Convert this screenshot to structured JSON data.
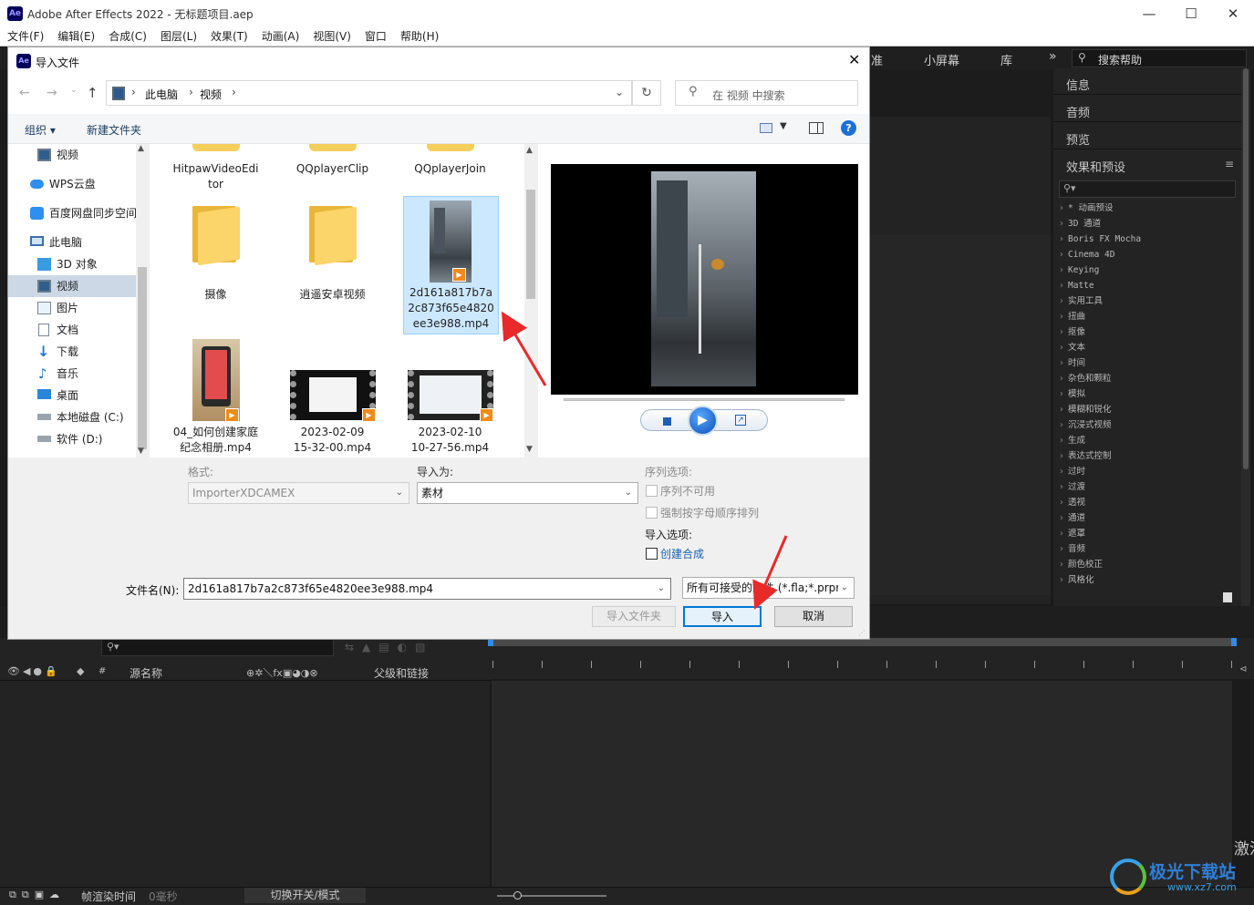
{
  "app": {
    "title": "Adobe After Effects 2022 - 无标题项目.aep",
    "logo": "Ae",
    "menu": [
      "文件(F)",
      "编辑(E)",
      "合成(C)",
      "图层(L)",
      "效果(T)",
      "动画(A)",
      "视图(V)",
      "窗口",
      "帮助(H)"
    ]
  },
  "workspace": {
    "tabs": [
      "准",
      "小屏幕",
      "库"
    ],
    "search_help": "搜索帮助",
    "right_panels": [
      "信息",
      "音频",
      "预览",
      "效果和预设"
    ],
    "effects": [
      "* 动画预设",
      "3D 通道",
      "Boris FX Mocha",
      "Cinema 4D",
      "Keying",
      "Matte",
      "实用工具",
      "扭曲",
      "抠像",
      "文本",
      "时间",
      "杂色和颗粒",
      "模拟",
      "模糊和锐化",
      "沉浸式视频",
      "生成",
      "表达式控制",
      "过时",
      "过渡",
      "透视",
      "通道",
      "遮罩",
      "音频",
      "颜色校正",
      "风格化"
    ],
    "timeline_columns": {
      "source_name": "源名称",
      "parent": "父级和链接"
    },
    "bottom_bar": {
      "render_time_label": "帧渲染时间",
      "render_time_value": "0毫秒",
      "toggle_label": "切换开关/模式"
    }
  },
  "dialog": {
    "title": "导入文件",
    "breadcrumb": [
      "此电脑",
      "视频"
    ],
    "search_placeholder": "在 视频 中搜索",
    "toolbar": {
      "organize": "组织",
      "new_folder": "新建文件夹"
    },
    "nav_items": [
      {
        "label": "视频",
        "icon": "video-folder-icon"
      },
      {
        "label": "WPS云盘",
        "icon": "cloud-icon"
      },
      {
        "label": "百度网盘同步空间",
        "icon": "baidu-icon"
      },
      {
        "label": "此电脑",
        "icon": "computer-icon"
      },
      {
        "label": "3D 对象",
        "icon": "cube-icon"
      },
      {
        "label": "视频",
        "icon": "video-folder-icon"
      },
      {
        "label": "图片",
        "icon": "pictures-icon"
      },
      {
        "label": "文档",
        "icon": "documents-icon"
      },
      {
        "label": "下载",
        "icon": "download-icon"
      },
      {
        "label": "音乐",
        "icon": "music-icon"
      },
      {
        "label": "桌面",
        "icon": "desktop-icon"
      },
      {
        "label": "本地磁盘 (C:)",
        "icon": "drive-icon"
      },
      {
        "label": "软件 (D:)",
        "icon": "drive-icon"
      }
    ],
    "files": [
      {
        "name": "HitpawVideoEditor",
        "lines": [
          "HitpawVideoEdi",
          "tor"
        ]
      },
      {
        "name": "QQplayerClip",
        "lines": [
          "QQplayerClip"
        ]
      },
      {
        "name": "QQplayerJoin",
        "lines": [
          "QQplayerJoin"
        ]
      },
      {
        "name": "摄像",
        "lines": [
          "摄像"
        ]
      },
      {
        "name": "逍遥安卓视频",
        "lines": [
          "逍遥安卓视频"
        ]
      },
      {
        "name": "2d161a817b7a2c873f65e4820ee3e988.mp4",
        "lines": [
          "2d161a817b7a",
          "2c873f65e4820",
          "ee3e988.mp4"
        ]
      },
      {
        "name": "04_如何创建家庭纪念相册.mp4",
        "lines": [
          "04_如何创建家庭",
          "纪念相册.mp4"
        ]
      },
      {
        "name": "2023-02-09 15-32-00.mp4",
        "lines": [
          "2023-02-09",
          "15-32-00.mp4"
        ]
      },
      {
        "name": "2023-02-10 10-27-56.mp4",
        "lines": [
          "2023-02-10",
          "10-27-56.mp4"
        ]
      }
    ],
    "options": {
      "format_label": "格式:",
      "format_value": "ImporterXDCAMEX",
      "import_as_label": "导入为:",
      "import_as_value": "素材",
      "sequence_label": "序列选项:",
      "sequence_unavailable": "序列不可用",
      "force_alpha": "强制按字母顺序排列",
      "import_options_label": "导入选项:",
      "create_comp": "创建合成"
    },
    "filename_label": "文件名(N):",
    "filename_value": "2d161a817b7a2c873f65e4820ee3e988.mp4",
    "filetype_value": "所有可接受的文件 (*.fla;*.prpr",
    "buttons": {
      "import_folder": "导入文件夹",
      "import": "导入",
      "cancel": "取消"
    }
  },
  "watermark": {
    "text": "极光下载站",
    "url": "www.xz7.com",
    "side": "激活"
  }
}
